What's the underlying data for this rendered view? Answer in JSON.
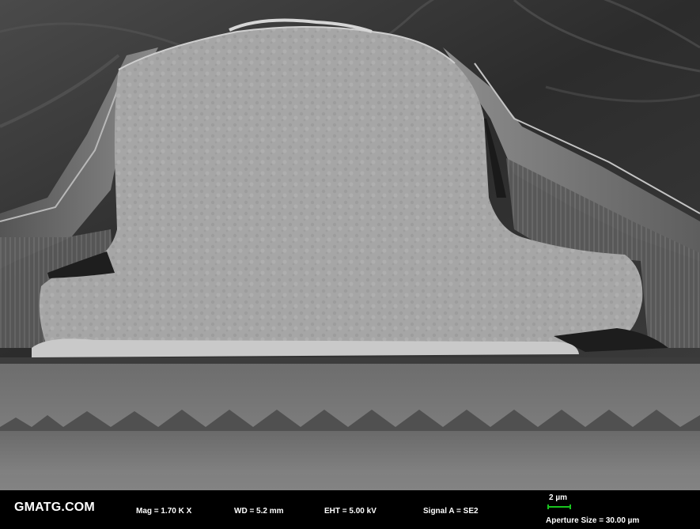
{
  "image": {
    "subject": "SEM cross-section micrograph",
    "colors": {
      "scale_bar": "#19c41f",
      "background": "#000000",
      "text": "#ffffff"
    }
  },
  "databar": {
    "logo": "GMATG.COM",
    "mag": "Mag =   1.70 K X",
    "wd": "WD =  5.2 mm",
    "eht": "EHT =  5.00 kV",
    "signal": "Signal A = SE2",
    "scale_label": "2 µm",
    "aperture": "Aperture Size = 30.00 µm"
  }
}
